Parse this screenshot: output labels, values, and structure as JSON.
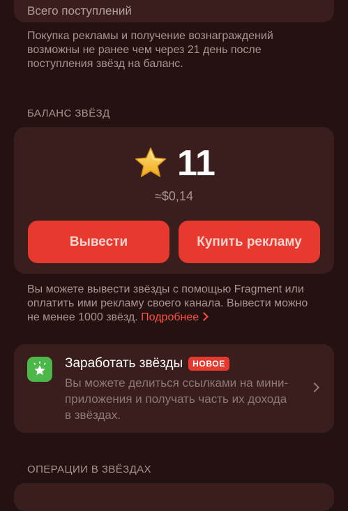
{
  "top_card": {
    "label": "Всего поступлений"
  },
  "notes": {
    "withdraw_delay": "Покупка рекламы и получение вознаграждений возможны не ранее чем через 21 день после поступления звёзд на баланс.",
    "withdraw_info": "Вы можете вывести звёзды с помощью Fragment или оплатить ими рекламу своего канала. Вывести можно не менее 1000 звёзд.",
    "more_link": "Подробнее"
  },
  "balance": {
    "section_title": "БАЛАНС ЗВЁЗД",
    "amount": "11",
    "usd": "≈$0,14",
    "withdraw_label": "Вывести",
    "buy_ads_label": "Купить рекламу"
  },
  "earn": {
    "title": "Заработать звёзды",
    "badge": "НОВОЕ",
    "description": "Вы можете делиться ссылками на мини-приложения и получать часть их дохода в звёздах."
  },
  "operations": {
    "section_title": "ОПЕРАЦИИ В ЗВЁЗДАХ"
  },
  "colors": {
    "background": "#241212",
    "card": "#3a1e1e",
    "accent": "#e8392f",
    "earn_icon": "#4cb84a",
    "star": "#f7c23a"
  }
}
